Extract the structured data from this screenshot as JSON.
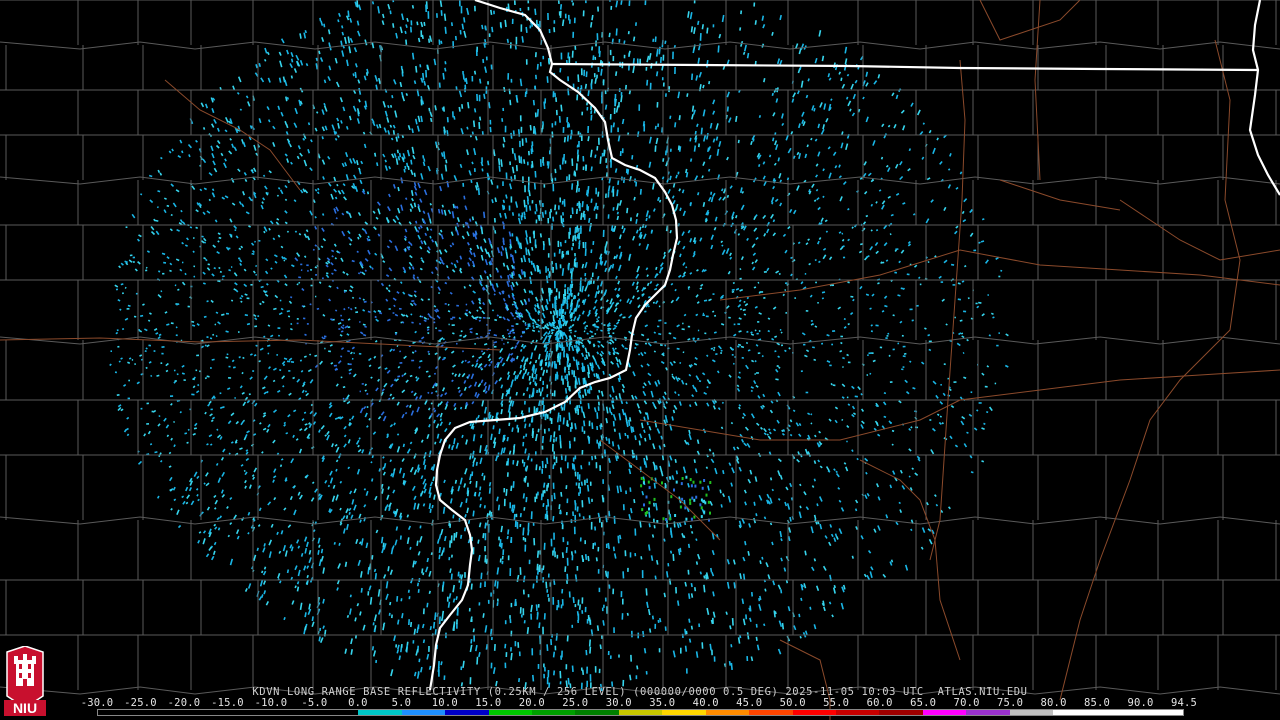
{
  "caption": "KDVN LONG RANGE BASE REFLECTIVITY (0.25KM / 256 LEVEL) (000000/0000 0.5 DEG) 2025-11-05 10:03 UTC  ATLAS.NIU.EDU",
  "logo_text": "NIU",
  "scale": {
    "ticks": [
      "-30.0",
      "-25.0",
      "-20.0",
      "-15.0",
      "-10.0",
      "-5.0",
      "0.0",
      "5.0",
      "10.0",
      "15.0",
      "20.0",
      "25.0",
      "30.0",
      "35.0",
      "40.0",
      "45.0",
      "50.0",
      "55.0",
      "60.0",
      "65.0",
      "70.0",
      "75.0",
      "80.0",
      "85.0",
      "90.0",
      "94.5"
    ],
    "colors": [
      "#000000",
      "#000000",
      "#000000",
      "#000000",
      "#000000",
      "#000000",
      "#00c8c8",
      "#1e90ff",
      "#0000c8",
      "#00c800",
      "#00a000",
      "#008000",
      "#c8c800",
      "#ffd700",
      "#ff8c00",
      "#ff4500",
      "#ff0000",
      "#c80000",
      "#a00000",
      "#ff00ff",
      "#9932cc",
      "#c0c0c0",
      "#ffffff",
      "#ffffff",
      "#ffffff"
    ]
  },
  "colors": {
    "background": "#000000",
    "county_lines": "#5a5a5a",
    "state_lines": "#ffffff",
    "highways": "#8b4a2b",
    "echo_light": "#19b6e6",
    "echo_cyan": "#36d6ee",
    "echo_blue": "#2a6fe0",
    "echo_green": "#20c020"
  }
}
